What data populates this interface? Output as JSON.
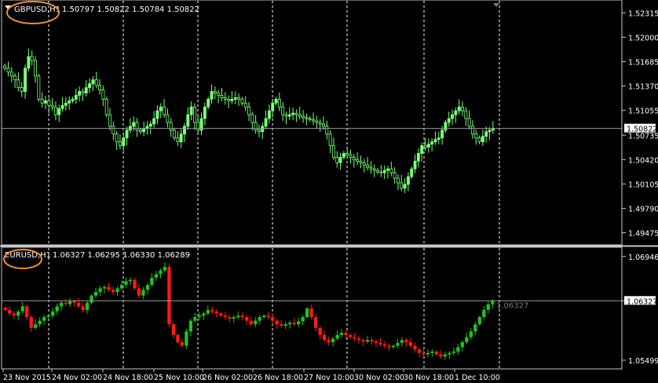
{
  "window": {
    "background": "#000000",
    "grid_color": "#ffffff",
    "frame_color": "#c8c8c8",
    "annotation_color": "#f08c3c"
  },
  "panes": [
    {
      "id": "top",
      "symbol_label": "GBPUSD,H1",
      "ohlc_label": "1.50797 1.50822 1.50784 1.50822",
      "bull_color": "#7cff7c",
      "bear_color": "#7cff7c",
      "price_min": 1.4944,
      "price_max": 1.5238,
      "current_price": 1.50822,
      "current_price_label": "1.50822",
      "price_labels": [
        "1.52315",
        "1.52000",
        "1.51685",
        "1.51370",
        "1.51055",
        "1.50735",
        "1.50420",
        "1.50105",
        "1.49790",
        "1.49475"
      ],
      "price_values": [
        1.52315,
        1.52,
        1.51685,
        1.5137,
        1.51055,
        1.50735,
        1.5042,
        1.50105,
        1.4979,
        1.49475
      ],
      "series": [
        {
          "name": "candles",
          "closes": [
            1.516,
            1.5155,
            1.515,
            1.5145,
            1.5135,
            1.513,
            1.516,
            1.5175,
            1.517,
            1.515,
            1.512,
            1.5115,
            1.5118,
            1.5112,
            1.511,
            1.51,
            1.5108,
            1.5112,
            1.5115,
            1.5118,
            1.512,
            1.5125,
            1.513,
            1.5128,
            1.5135,
            1.514,
            1.5145,
            1.5138,
            1.5132,
            1.512,
            1.51,
            1.5085,
            1.5075,
            1.5065,
            1.506,
            1.507,
            1.508,
            1.5085,
            1.509,
            1.508,
            1.5078,
            1.5082,
            1.5085,
            1.5088,
            1.5095,
            1.5105,
            1.511,
            1.51,
            1.509,
            1.508,
            1.507,
            1.5065,
            1.5075,
            1.5085,
            1.51,
            1.511,
            1.509,
            1.508,
            1.5095,
            1.511,
            1.512,
            1.513,
            1.5128,
            1.5125,
            1.5122,
            1.512,
            1.5118,
            1.512,
            1.5122,
            1.512,
            1.5115,
            1.511,
            1.51,
            1.509,
            1.508,
            1.5078,
            1.5085,
            1.5095,
            1.5105,
            1.5115,
            1.512,
            1.511,
            1.51,
            1.5098,
            1.51,
            1.5102,
            1.51,
            1.5098,
            1.5096,
            1.5095,
            1.5094,
            1.5092,
            1.509,
            1.5088,
            1.5085,
            1.5075,
            1.506,
            1.5045,
            1.5038,
            1.5045,
            1.505,
            1.5048,
            1.5045,
            1.5042,
            1.504,
            1.5038,
            1.5035,
            1.5032,
            1.503,
            1.5028,
            1.5026,
            1.5025,
            1.5028,
            1.503,
            1.5025,
            1.5018,
            1.5012,
            1.5005,
            1.501,
            1.502,
            1.503,
            1.504,
            1.505,
            1.506,
            1.5058,
            1.5062,
            1.5065,
            1.5068,
            1.507,
            1.508,
            1.509,
            1.5095,
            1.51,
            1.5105,
            1.511,
            1.5105,
            1.5095,
            1.5085,
            1.5075,
            1.507,
            1.5065,
            1.5072,
            1.5078,
            1.508,
            1.5082
          ]
        }
      ]
    },
    {
      "id": "bottom",
      "symbol_label": "EURUSD,H1",
      "ohlc_label": "1.06327 1.06295 1.06330 1.06289",
      "bull_color": "#22c022",
      "bear_color": "#ff1a1a",
      "price_min": 1.054,
      "price_max": 1.0702,
      "current_price": 1.06327,
      "current_price_label": "1.06327",
      "price_labels": [
        "1.06946",
        "1.06327",
        "1.05499"
      ],
      "price_values": [
        1.06946,
        1.06327,
        1.05499
      ],
      "series": [
        {
          "name": "candles",
          "closes": [
            1.062,
            1.0615,
            1.0612,
            1.0618,
            1.0625,
            1.061,
            1.0595,
            1.06,
            1.0605,
            1.061,
            1.0612,
            1.0618,
            1.0625,
            1.063,
            1.0628,
            1.0632,
            1.063,
            1.0625,
            1.062,
            1.063,
            1.064,
            1.0645,
            1.065,
            1.0652,
            1.0648,
            1.0645,
            1.065,
            1.0655,
            1.066,
            1.0662,
            1.065,
            1.064,
            1.0648,
            1.0655,
            1.0665,
            1.067,
            1.0675,
            1.068,
            1.06,
            1.0585,
            1.0575,
            1.057,
            1.059,
            1.0605,
            1.061,
            1.0612,
            1.0615,
            1.062,
            1.0618,
            1.0615,
            1.0612,
            1.061,
            1.0608,
            1.061,
            1.0612,
            1.061,
            1.0605,
            1.06,
            1.0605,
            1.061,
            1.0612,
            1.061,
            1.0605,
            1.06,
            1.0598,
            1.06,
            1.0602,
            1.06,
            1.0604,
            1.061,
            1.0622,
            1.061,
            1.0595,
            1.0585,
            1.0578,
            1.0575,
            1.058,
            1.0585,
            1.0588,
            1.0585,
            1.0582,
            1.058,
            1.0578,
            1.0576,
            1.0578,
            1.0576,
            1.0574,
            1.0572,
            1.057,
            1.0568,
            1.057,
            1.0574,
            1.0578,
            1.0575,
            1.057,
            1.0565,
            1.056,
            1.0558,
            1.056,
            1.0562,
            1.0558,
            1.0555,
            1.0558,
            1.056,
            1.0562,
            1.0568,
            1.0575,
            1.0582,
            1.059,
            1.06,
            1.061,
            1.062,
            1.0628,
            1.0633
          ]
        }
      ]
    }
  ],
  "time_axis": {
    "labels": [
      "23 Nov 2015",
      "24 Nov 02:00",
      "24 Nov 18:00",
      "25 Nov 10:00",
      "26 Nov 02:00",
      "26 Nov 18:00",
      "27 Nov 10:00",
      "30 Nov 02:00",
      "30 Nov 18:00",
      "1 Dec 10:00"
    ]
  },
  "icons": [
    {
      "name": "chart-menu-triangle-icon",
      "color": "#ffffff"
    },
    {
      "name": "scroll-marker-icon",
      "color": "#6e7f8f"
    }
  ]
}
